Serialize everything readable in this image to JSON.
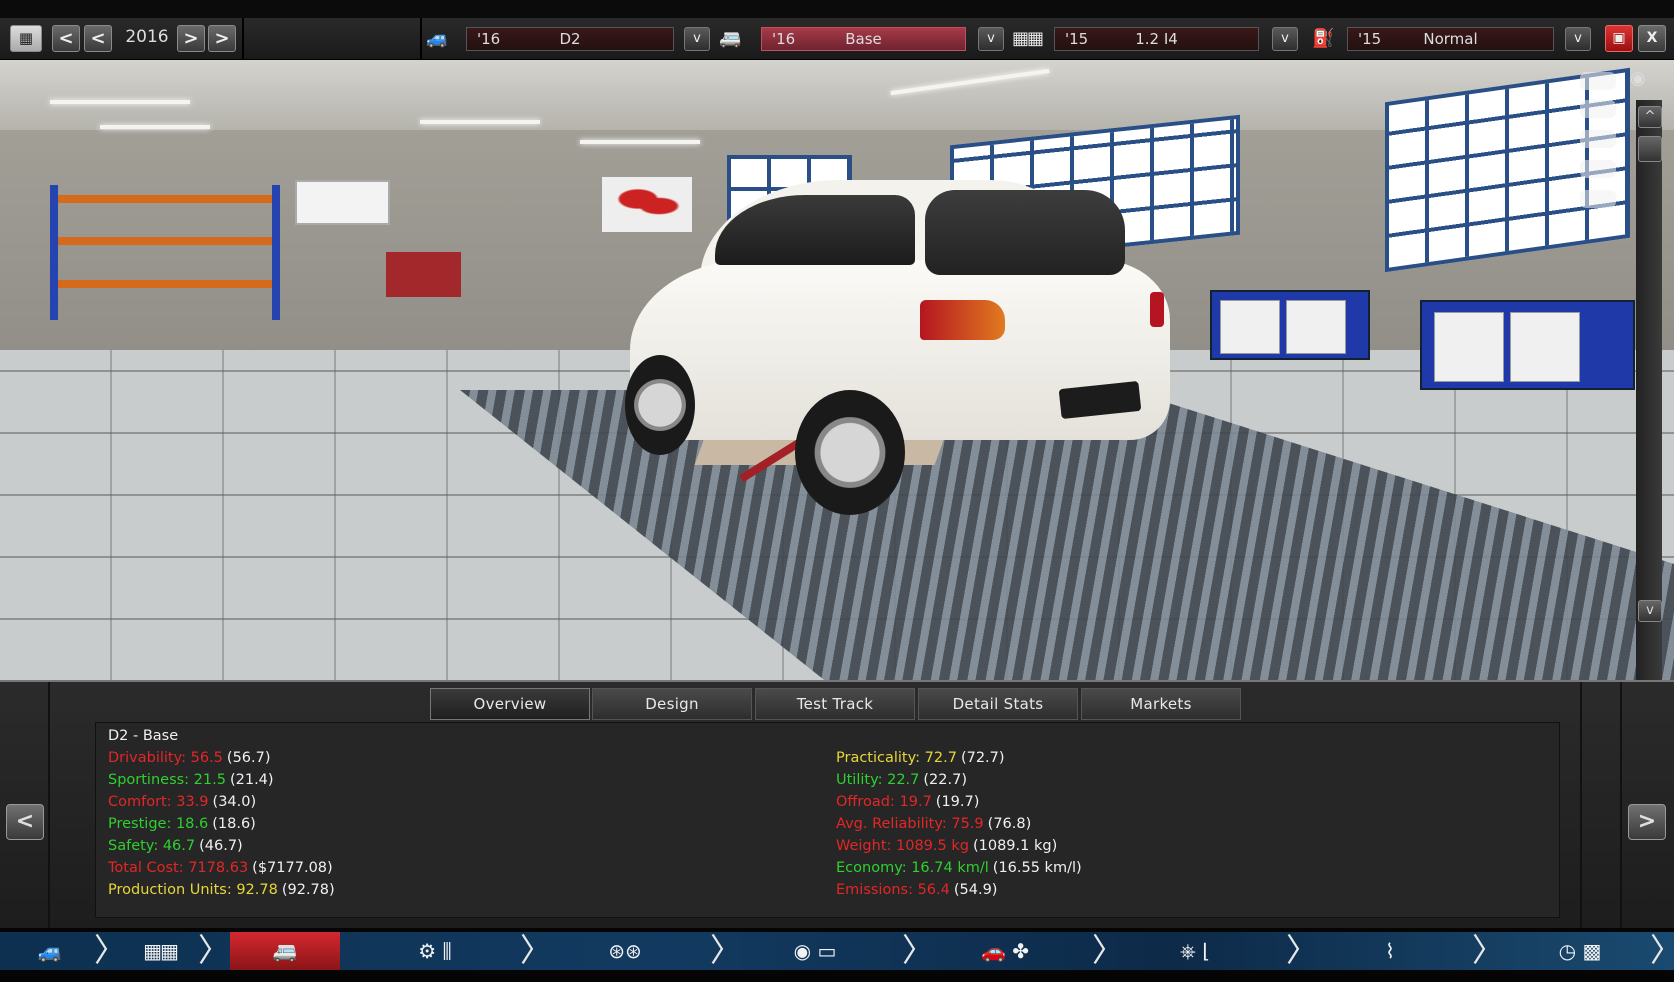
{
  "topbar": {
    "year": "2016",
    "model": {
      "year": "'16",
      "name": "D2"
    },
    "trim": {
      "year": "'16",
      "name": "Base"
    },
    "engine": {
      "year": "'15",
      "name": "1.2 I4"
    },
    "fixture": {
      "year": "'15",
      "name": "Normal"
    },
    "nav_prev_fast": "<",
    "nav_prev": "<",
    "nav_next": ">",
    "nav_next_fast": ">",
    "dropdown_label": "v",
    "close_label": "X"
  },
  "scroll": {
    "up": "^",
    "down": "v"
  },
  "tabs": [
    "Overview",
    "Design",
    "Test Track",
    "Detail Stats",
    "Markets"
  ],
  "overview": {
    "title": "D2 - Base",
    "left_stats": [
      {
        "label": "Drivability: 56.5",
        "prev": "(56.7)",
        "color": "red"
      },
      {
        "label": "Sportiness: 21.5",
        "prev": "(21.4)",
        "color": "green"
      },
      {
        "label": "Comfort: 33.9",
        "prev": "(34.0)",
        "color": "red"
      },
      {
        "label": "Prestige: 18.6",
        "prev": "(18.6)",
        "color": "green"
      },
      {
        "label": "Safety: 46.7",
        "prev": "(46.7)",
        "color": "green"
      },
      {
        "label": "Total Cost: 7178.63",
        "prev": "($7177.08)",
        "color": "red"
      },
      {
        "label": "Production Units: 92.78",
        "prev": "(92.78)",
        "color": "yellow"
      }
    ],
    "right_stats": [
      {
        "label": "Practicality: 72.7",
        "prev": "(72.7)",
        "color": "yellow"
      },
      {
        "label": "Utility: 22.7",
        "prev": "(22.7)",
        "color": "green"
      },
      {
        "label": "Offroad: 19.7",
        "prev": "(19.7)",
        "color": "red"
      },
      {
        "label": "Avg. Reliability: 75.9",
        "prev": "(76.8)",
        "color": "red"
      },
      {
        "label": "Weight: 1089.5 kg",
        "prev": "(1089.1 kg)",
        "color": "red"
      },
      {
        "label": "Economy: 16.74 km/l",
        "prev": "(16.55 km/l)",
        "color": "green"
      },
      {
        "label": "Emissions: 56.4",
        "prev": "(54.9)",
        "color": "red"
      }
    ],
    "prev_page": "<",
    "next_page": ">"
  },
  "colors": {
    "red": "#e32626",
    "green": "#2fcf2f",
    "yellow": "#e6d63a",
    "accent": "#c0283a"
  },
  "bottom_nav": [
    {
      "icon": "car-model-icon"
    },
    {
      "icon": "engine-icon"
    },
    {
      "icon": "trim-body-icon",
      "active": true
    },
    {
      "icon": "drivetrain-gearbox-icon"
    },
    {
      "icon": "wheels-icon"
    },
    {
      "icon": "brakes-icon"
    },
    {
      "icon": "aero-cooling-icon"
    },
    {
      "icon": "interior-icon"
    },
    {
      "icon": "suspension-icon"
    },
    {
      "icon": "test-track-icon"
    }
  ]
}
